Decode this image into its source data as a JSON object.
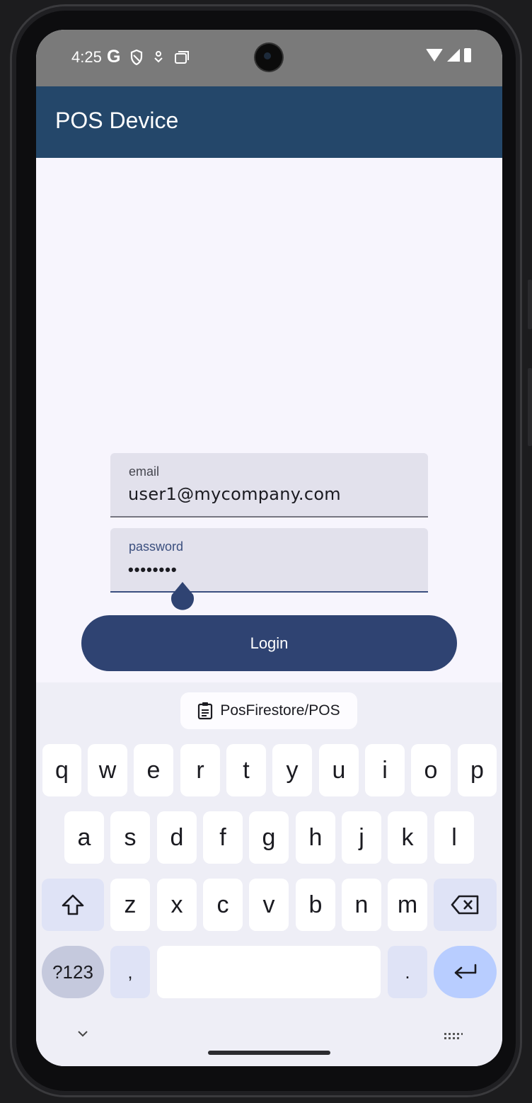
{
  "status_bar": {
    "time": "4:25",
    "left_icons": [
      "google-icon",
      "shield-icon",
      "download-icon",
      "copy-icon"
    ],
    "right_icons": [
      "wifi-icon",
      "signal-icon",
      "battery-icon"
    ]
  },
  "app_bar": {
    "title": "POS Device",
    "color": "#24476a"
  },
  "form": {
    "email": {
      "label": "email",
      "value": "user1@mycompany.com"
    },
    "password": {
      "label": "password",
      "value": "••••••••"
    },
    "login_label": "Login",
    "accent": "#2f4372"
  },
  "keyboard": {
    "suggestion": "PosFirestore/POS",
    "row1": [
      "q",
      "w",
      "e",
      "r",
      "t",
      "y",
      "u",
      "i",
      "o",
      "p"
    ],
    "row2": [
      "a",
      "s",
      "d",
      "f",
      "g",
      "h",
      "j",
      "k",
      "l"
    ],
    "row3": [
      "z",
      "x",
      "c",
      "v",
      "b",
      "n",
      "m"
    ],
    "symbols_label": "?123",
    "comma": ",",
    "period": "."
  }
}
